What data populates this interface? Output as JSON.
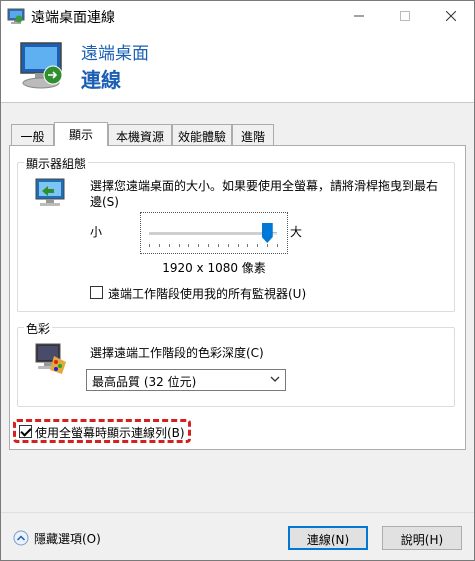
{
  "window": {
    "title": "遠端桌面連線"
  },
  "banner": {
    "line1": "遠端桌面",
    "line2": "連線"
  },
  "tabs": [
    {
      "label": "一般"
    },
    {
      "label": "顯示"
    },
    {
      "label": "本機資源"
    },
    {
      "label": "效能體驗"
    },
    {
      "label": "進階"
    }
  ],
  "active_tab": "顯示",
  "display_config": {
    "group_label": "顯示器組態",
    "description": "選擇您遠端桌面的大小。如果要使用全螢幕，請將滑桿拖曳到最右邊(S)",
    "small_label": "小",
    "large_label": "大",
    "slider_level": 0.92,
    "resolution": "1920 x 1080 像素",
    "all_monitors_label": "遠端工作階段使用我的所有監視器(U)",
    "all_monitors_checked": false
  },
  "colors": {
    "group_label": "色彩",
    "description": "選擇遠端工作階段的色彩深度(C)",
    "selected": "最高品質 (32 位元)"
  },
  "connection_bar": {
    "label": "使用全螢幕時顯示連線列(B)",
    "checked": true
  },
  "footer": {
    "hide_options": "隱藏選項(O)",
    "connect": "連線(N)",
    "help": "說明(H)"
  },
  "theme": {
    "accent": "#0078d7",
    "title_blue": "#1b5fb5",
    "highlight": "#d42020"
  }
}
